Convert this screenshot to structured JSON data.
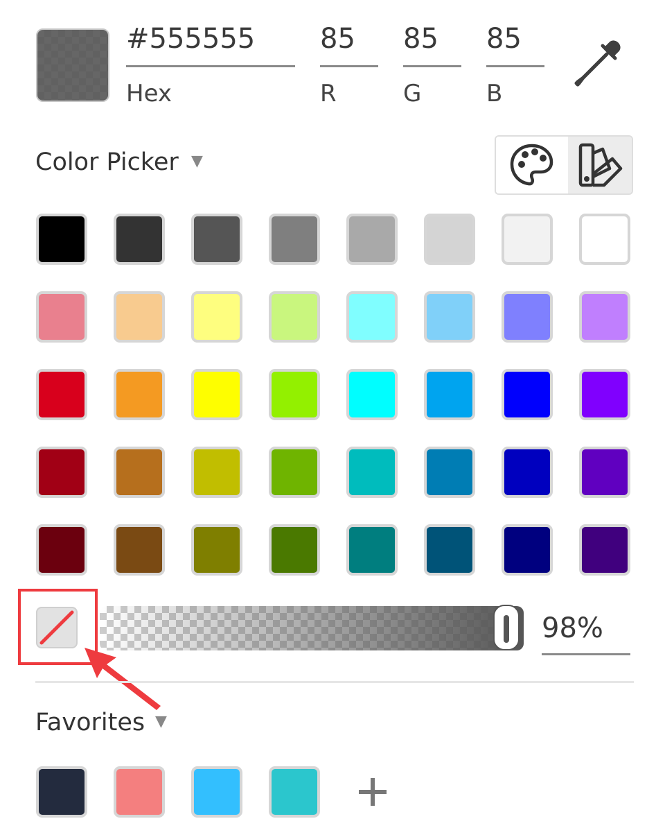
{
  "current_color": {
    "hex_value": "#555555",
    "r": "85",
    "g": "85",
    "b": "85",
    "alpha_percent": "98%"
  },
  "fields": {
    "hex_label": "Hex",
    "r_label": "R",
    "g_label": "G",
    "b_label": "B"
  },
  "icons": {
    "eyedropper": "eyedropper-icon",
    "palette": "palette-icon",
    "swatches": "swatches-icon",
    "no_color": "no-color-icon",
    "add": "plus-icon",
    "dropdown": "caret-down-icon"
  },
  "picker": {
    "title": "Color Picker",
    "caret": "▼"
  },
  "palette_rows": [
    [
      "#000000",
      "#333333",
      "#555555",
      "#7f7f7f",
      "#a9a9a9",
      "#d4d4d4",
      "#f2f2f2",
      "#ffffff"
    ],
    [
      "#e9808e",
      "#f8cb8f",
      "#fefe7f",
      "#c9f67e",
      "#80feff",
      "#80d0f9",
      "#7f80fe",
      "#c07ffe"
    ],
    [
      "#d8001c",
      "#f49a22",
      "#fefe00",
      "#93f000",
      "#00feff",
      "#00a4ef",
      "#0000fd",
      "#8000fe"
    ],
    [
      "#a10015",
      "#b66f1d",
      "#c1be00",
      "#6fb400",
      "#00bcbd",
      "#007db4",
      "#0000bf",
      "#6000c0"
    ],
    [
      "#6b000e",
      "#7a4a13",
      "#7f7f00",
      "#4a7900",
      "#007e7f",
      "#005378",
      "#00007f",
      "#40007e"
    ]
  ],
  "favorites": {
    "title": "Favorites",
    "caret": "▼",
    "colors": [
      "#232b3e",
      "#f47f7f",
      "#33bffe",
      "#2bc6cd"
    ],
    "add_label": "+"
  },
  "accent": {
    "annotation_red": "#ee3b3f"
  }
}
